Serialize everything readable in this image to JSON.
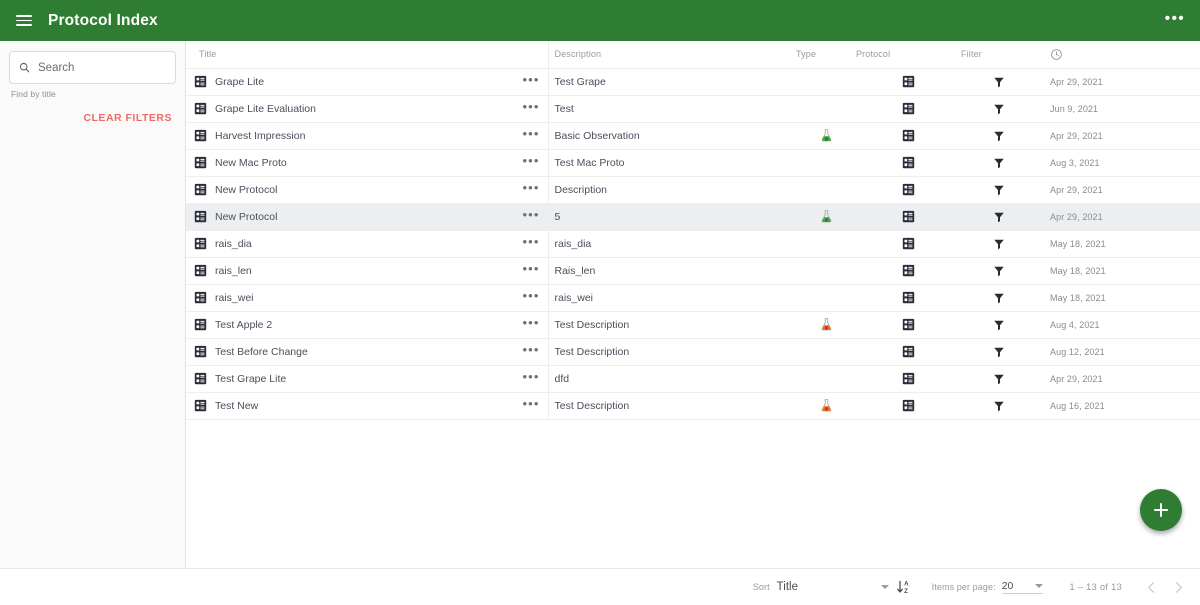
{
  "appbar": {
    "menu_icon": "hamburger-icon",
    "title": "Protocol Index",
    "overflow_icon": "more-vert-icon",
    "overflow_label": "•••",
    "bg_color": "#2f7d32"
  },
  "sidebar": {
    "search": {
      "icon": "search-icon",
      "value": "",
      "placeholder": "Search"
    },
    "hint": "Find by title",
    "clear_filters_label": "CLEAR FILTERS",
    "clear_filters_color": "#ef6a64"
  },
  "table": {
    "columns": [
      {
        "key": "title",
        "label": "Title"
      },
      {
        "key": "description",
        "label": "Description"
      },
      {
        "key": "type",
        "label": "Type"
      },
      {
        "key": "protocol",
        "label": "Protocol"
      },
      {
        "key": "filter",
        "label": "Filter"
      },
      {
        "key": "date",
        "label": "",
        "icon": "clock-icon"
      }
    ],
    "row_menu_label": "•••",
    "row_icon": "protocol-grid-icon",
    "rows": [
      {
        "title": "Grape Lite",
        "description": "Test Grape",
        "type": "",
        "protocol": "protocol-grid-icon",
        "filter": "funnel-icon",
        "date": "Apr 29, 2021",
        "selected": false
      },
      {
        "title": "Grape Lite Evaluation",
        "description": "Test",
        "type": "",
        "protocol": "protocol-grid-icon",
        "filter": "funnel-icon",
        "date": "Jun 9, 2021",
        "selected": false
      },
      {
        "title": "Harvest Impression",
        "description": "Basic Observation",
        "type": "flask-green",
        "protocol": "protocol-grid-icon",
        "filter": "funnel-icon",
        "date": "Apr 29, 2021",
        "selected": false
      },
      {
        "title": "New Mac Proto",
        "description": "Test Mac Proto",
        "type": "",
        "protocol": "protocol-grid-icon",
        "filter": "funnel-icon",
        "date": "Aug 3, 2021",
        "selected": false
      },
      {
        "title": "New Protocol",
        "description": "Description",
        "type": "",
        "protocol": "protocol-grid-icon",
        "filter": "funnel-icon",
        "date": "Apr 29, 2021",
        "selected": false
      },
      {
        "title": "New Protocol",
        "description": "5",
        "type": "flask-green",
        "protocol": "protocol-grid-icon",
        "filter": "funnel-icon",
        "date": "Apr 29, 2021",
        "selected": true
      },
      {
        "title": "rais_dia",
        "description": "rais_dia",
        "type": "",
        "protocol": "protocol-grid-icon",
        "filter": "funnel-icon",
        "date": "May 18, 2021",
        "selected": false
      },
      {
        "title": "rais_len",
        "description": "Rais_len",
        "type": "",
        "protocol": "protocol-grid-icon",
        "filter": "funnel-icon",
        "date": "May 18, 2021",
        "selected": false
      },
      {
        "title": "rais_wei",
        "description": "rais_wei",
        "type": "",
        "protocol": "protocol-grid-icon",
        "filter": "funnel-icon",
        "date": "May 18, 2021",
        "selected": false
      },
      {
        "title": "Test Apple 2",
        "description": "Test Description",
        "type": "flask-orange",
        "protocol": "protocol-grid-icon",
        "filter": "funnel-icon",
        "date": "Aug 4, 2021",
        "selected": false
      },
      {
        "title": "Test Before Change",
        "description": "Test Description",
        "type": "",
        "protocol": "protocol-grid-icon",
        "filter": "funnel-icon",
        "date": "Aug 12, 2021",
        "selected": false
      },
      {
        "title": "Test Grape Lite",
        "description": "dfd",
        "type": "",
        "protocol": "protocol-grid-icon",
        "filter": "funnel-icon",
        "date": "Apr 29, 2021",
        "selected": false
      },
      {
        "title": "Test New",
        "description": "Test Description",
        "type": "flask-orange",
        "protocol": "protocol-grid-icon",
        "filter": "funnel-icon",
        "date": "Aug 16, 2021",
        "selected": false
      }
    ]
  },
  "fab": {
    "icon": "plus-icon",
    "color": "#2e7d32"
  },
  "footer": {
    "sort_label": "Sort",
    "sort_value": "Title",
    "sort_direction_icon": "sort-az-descending-icon",
    "items_per_page_label": "Items per page:",
    "items_per_page_value": "20",
    "range_text": "1 – 13 of 13",
    "prev_icon": "chevron-left-icon",
    "next_icon": "chevron-right-icon"
  }
}
